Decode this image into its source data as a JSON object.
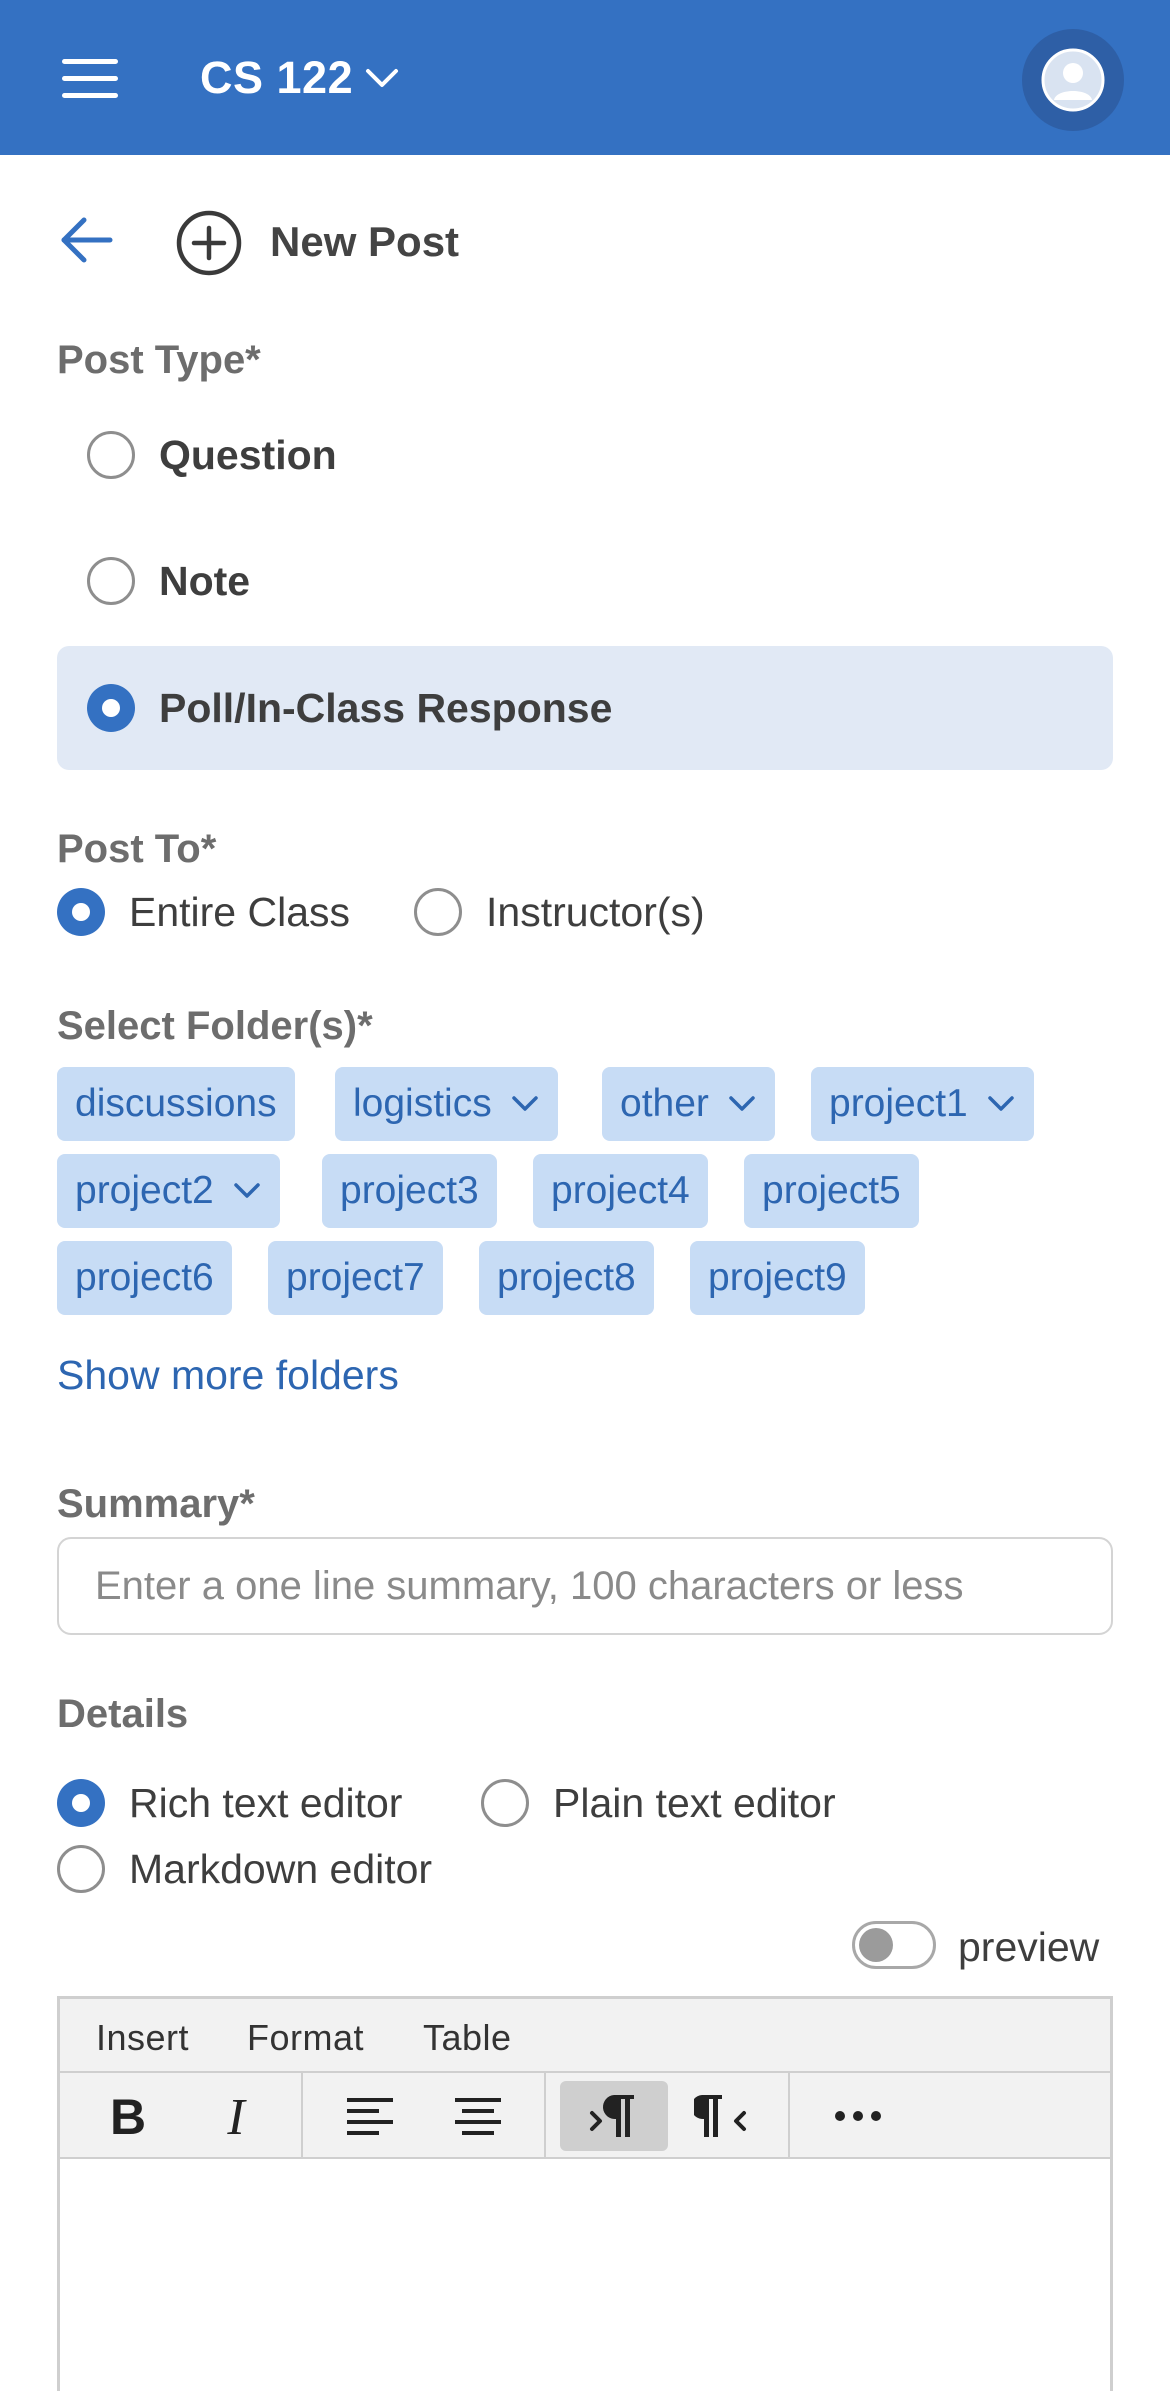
{
  "header": {
    "course": "CS 122"
  },
  "page": {
    "title": "New Post"
  },
  "post_type": {
    "label": "Post Type*",
    "options": [
      {
        "label": "Question",
        "selected": false
      },
      {
        "label": "Note",
        "selected": false
      },
      {
        "label": "Poll/In-Class Response",
        "selected": true
      }
    ]
  },
  "post_to": {
    "label": "Post To*",
    "options": [
      {
        "label": "Entire Class",
        "selected": true
      },
      {
        "label": "Instructor(s)",
        "selected": false
      }
    ]
  },
  "folders": {
    "label": "Select Folder(s)*",
    "items": [
      {
        "label": "discussions",
        "has_dropdown": false
      },
      {
        "label": "logistics",
        "has_dropdown": true
      },
      {
        "label": "other",
        "has_dropdown": true
      },
      {
        "label": "project1",
        "has_dropdown": true
      },
      {
        "label": "project2",
        "has_dropdown": true
      },
      {
        "label": "project3",
        "has_dropdown": false
      },
      {
        "label": "project4",
        "has_dropdown": false
      },
      {
        "label": "project5",
        "has_dropdown": false
      },
      {
        "label": "project6",
        "has_dropdown": false
      },
      {
        "label": "project7",
        "has_dropdown": false
      },
      {
        "label": "project8",
        "has_dropdown": false
      },
      {
        "label": "project9",
        "has_dropdown": false
      }
    ],
    "show_more": "Show more folders"
  },
  "summary": {
    "label": "Summary*",
    "value": "",
    "placeholder": "Enter a one line summary, 100 characters or less"
  },
  "details": {
    "label": "Details",
    "editor_modes": [
      {
        "label": "Rich text editor",
        "selected": true
      },
      {
        "label": "Plain text editor",
        "selected": false
      },
      {
        "label": "Markdown editor",
        "selected": false
      }
    ],
    "preview_label": "preview",
    "preview_on": false
  },
  "editor": {
    "menus": [
      "Insert",
      "Format",
      "Table"
    ],
    "tools": [
      {
        "icon": "bold-icon",
        "glyph": "B",
        "active": false
      },
      {
        "icon": "italic-icon",
        "glyph": "I",
        "active": false
      },
      {
        "icon": "align-left-icon",
        "glyph": "",
        "active": false
      },
      {
        "icon": "align-center-icon",
        "glyph": "",
        "active": false
      },
      {
        "icon": "ltr-direction-icon",
        "glyph": "",
        "active": true
      },
      {
        "icon": "rtl-direction-icon",
        "glyph": "",
        "active": false
      },
      {
        "icon": "more-icon",
        "glyph": "•••",
        "active": false
      }
    ]
  },
  "colors": {
    "brand": "#3471c2",
    "chip_bg": "#c7dcf5",
    "chip_text": "#2d66b1",
    "selected_row": "#e1e9f5"
  }
}
